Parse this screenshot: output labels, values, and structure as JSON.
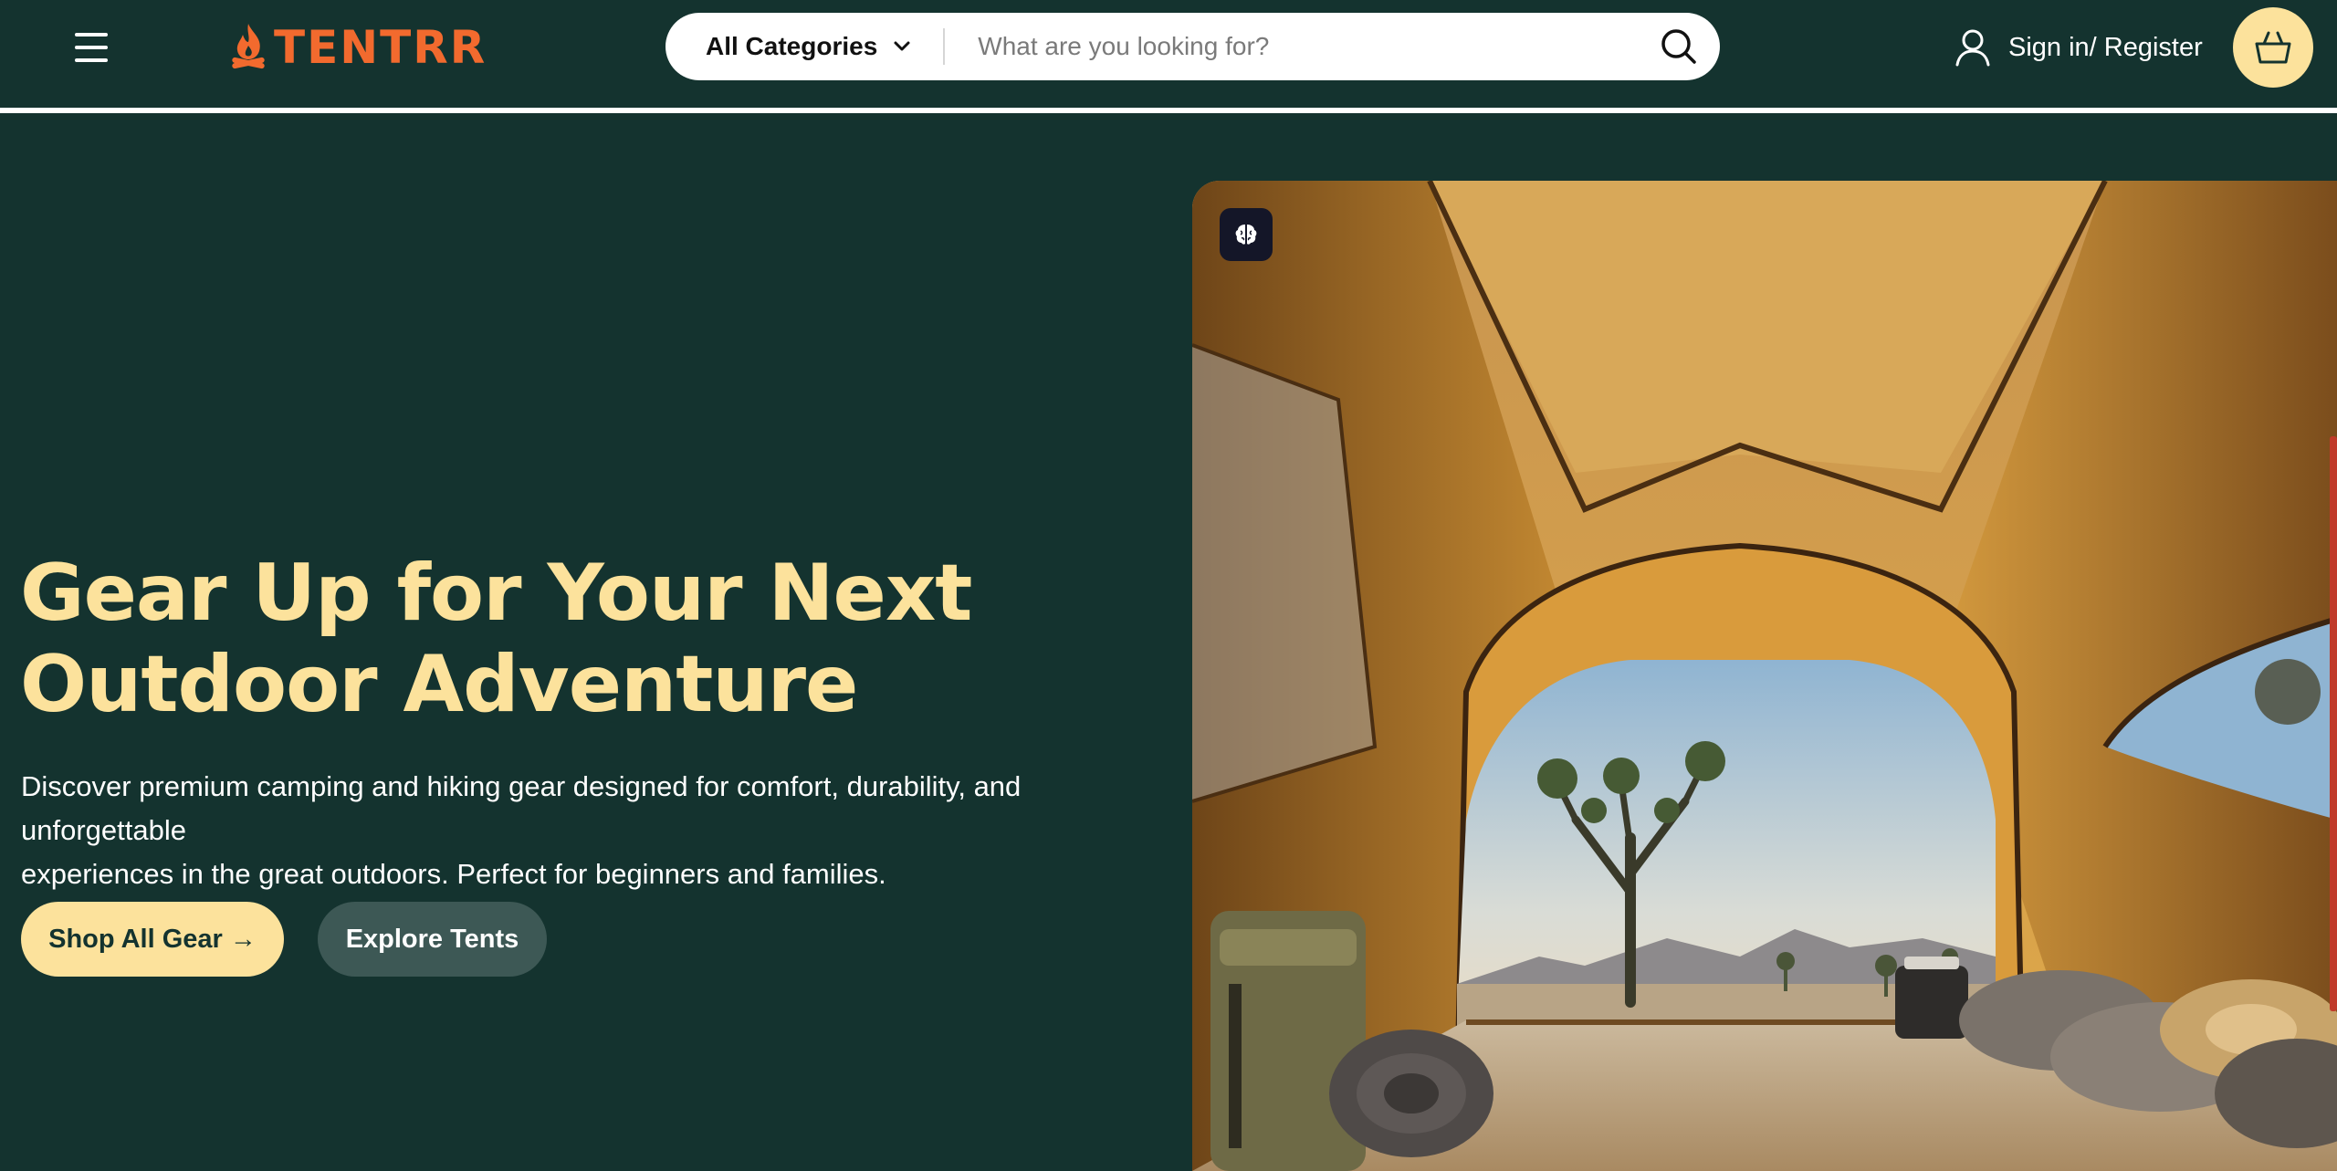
{
  "header": {
    "brand": "TENTRR",
    "category_select": "All Categories",
    "search_placeholder": "What are you looking for?",
    "signin_label": "Sign in/ Register"
  },
  "hero": {
    "title_line1": "Gear Up for Your Next",
    "title_line2": "Outdoor Adventure",
    "description_line1": "Discover premium camping and hiking gear designed for comfort, durability, and unforgettable",
    "description_line2": "experiences in the great outdoors. Perfect for beginners and families.",
    "primary_button": "Shop All Gear →",
    "secondary_button": "Explore Tents"
  },
  "icons": {
    "menu": "hamburger-menu-icon",
    "logo": "campfire-logo-icon",
    "category_chevron": "chevron-down-icon",
    "search": "search-icon",
    "user": "user-icon",
    "cart": "shopping-basket-icon",
    "badge": "brain-icon"
  },
  "colors": {
    "background": "#14332f",
    "accent": "#fce29c",
    "brand": "#f26a2e",
    "secondary_button": "#3d5855"
  }
}
